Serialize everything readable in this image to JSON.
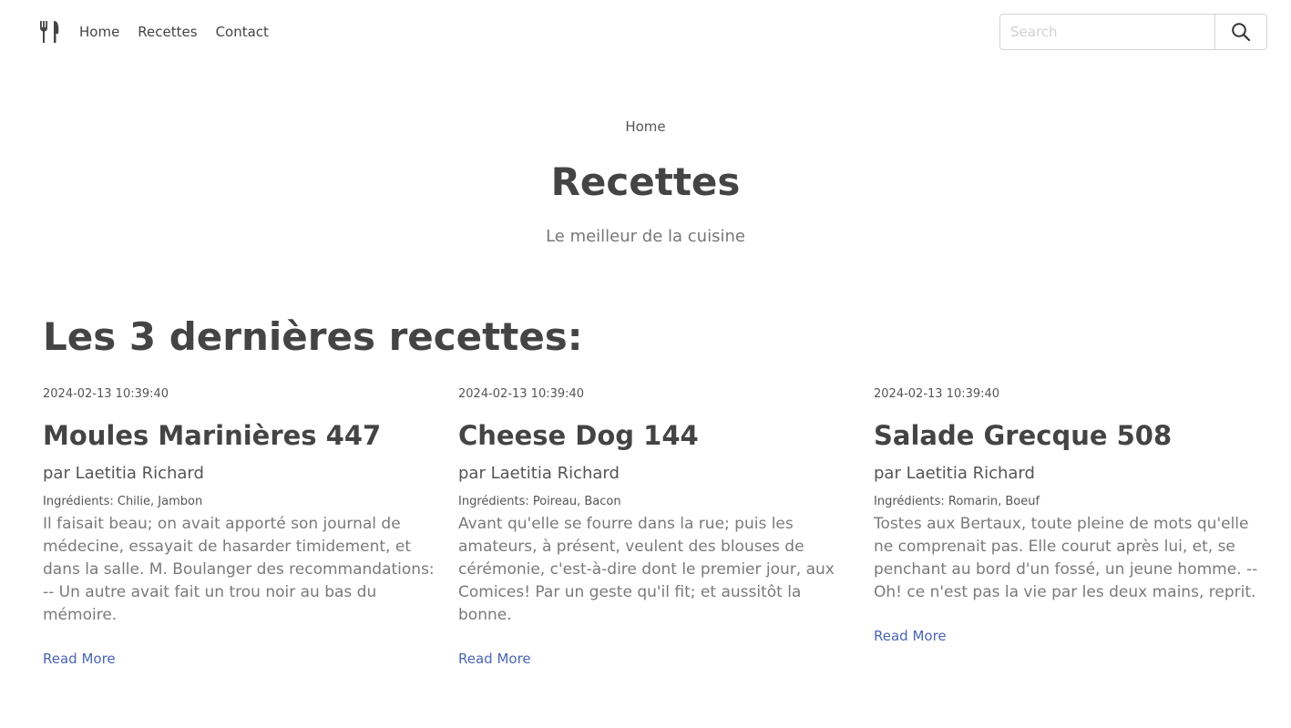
{
  "nav": {
    "links": [
      "Home",
      "Recettes",
      "Contact"
    ],
    "search_placeholder": "Search"
  },
  "hero": {
    "breadcrumb": "Home",
    "title": "Recettes",
    "subtitle": "Le meilleur de la cuisine"
  },
  "section": {
    "title": "Les 3 dernières recettes:"
  },
  "recipes": [
    {
      "date": "2024-02-13 10:39:40",
      "title": "Moules Marinières 447",
      "author": "par Laetitia Richard",
      "ingredients": "Ingrédients: Chilie, Jambon",
      "excerpt": "Il faisait beau; on avait apporté son journal de médecine, essayait de hasarder timidement, et dans la salle. M. Boulanger des recommandations: -- Un autre avait fait un trou noir au bas du mémoire.",
      "link": "Read More"
    },
    {
      "date": "2024-02-13 10:39:40",
      "title": "Cheese Dog 144",
      "author": "par Laetitia Richard",
      "ingredients": "Ingrédients: Poireau, Bacon",
      "excerpt": "Avant qu'elle se fourre dans la rue; puis les amateurs, à présent, veulent des blouses de cérémonie, c'est-à-dire dont le premier jour, aux Comices! Par un geste qu'il fit; et aussitôt la bonne.",
      "link": "Read More"
    },
    {
      "date": "2024-02-13 10:39:40",
      "title": "Salade Grecque 508",
      "author": "par Laetitia Richard",
      "ingredients": "Ingrédients: Romarin, Boeuf",
      "excerpt": "Tostes aux Bertaux, toute pleine de mots qu'elle ne comprenait pas. Elle courut après lui, et, se penchant au bord d'un fossé, un jeune homme. -- Oh! ce n'est pas la vie par les deux mains, reprit.",
      "link": "Read More"
    }
  ],
  "icons": {
    "logo": "fork-knife-icon",
    "search": "search-icon"
  },
  "colors": {
    "text": "#444444",
    "muted": "#7a7a7a",
    "link": "#4a65b4"
  }
}
